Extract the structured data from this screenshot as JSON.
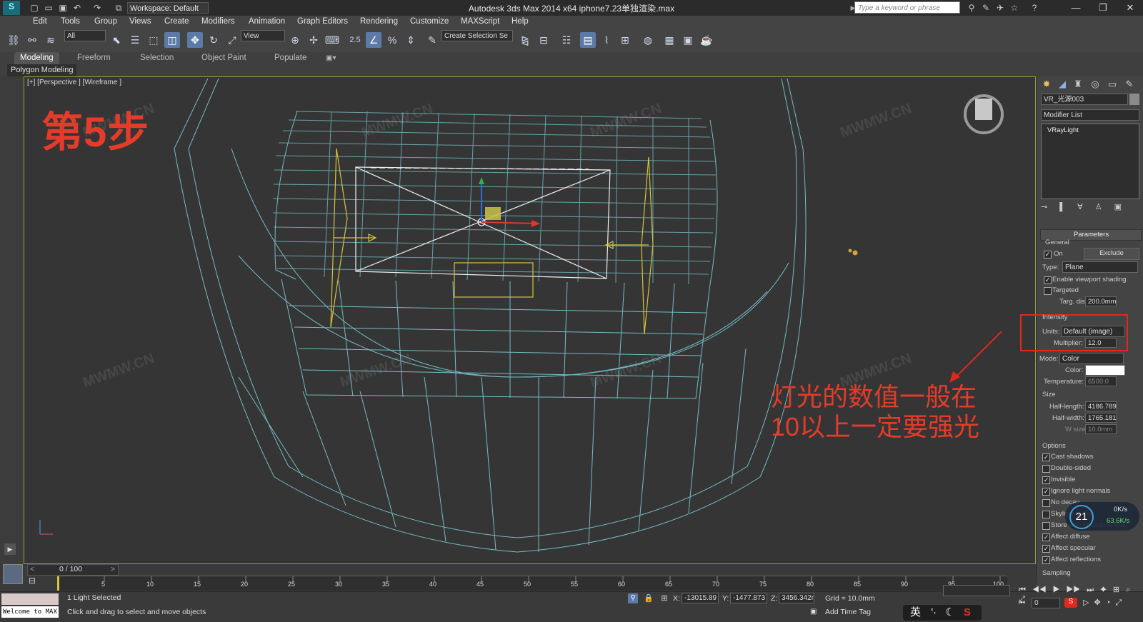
{
  "titlebar": {
    "workspace": "Workspace: Default",
    "title": "Autodesk 3ds Max  2014 x64      iphone7.23单独渲染.max",
    "search_placeholder": "Type a keyword or phrase"
  },
  "menu": [
    "Edit",
    "Tools",
    "Group",
    "Views",
    "Create",
    "Modifiers",
    "Animation",
    "Graph Editors",
    "Rendering",
    "Customize",
    "MAXScript",
    "Help"
  ],
  "toolbar": {
    "selection_filter": "All",
    "ref_coord": "View",
    "snap_value": "2.5",
    "named_selection": "Create Selection Se"
  },
  "ribbon": {
    "tabs": [
      "Modeling",
      "Freeform",
      "Selection",
      "Object Paint",
      "Populate"
    ],
    "active_tab": "Modeling",
    "panel": "Polygon Modeling"
  },
  "viewport": {
    "label": "[+] [Perspective ] [Wireframe ]",
    "step_text": "第5步",
    "annotation_line1": "灯光的数值一般在",
    "annotation_line2": "10以上一定要强光",
    "watermark": "MWMW.CN",
    "highlight_color": "#e0291c"
  },
  "command_panel": {
    "object_name": "VR_光源003",
    "modifier_list": "Modifier List",
    "stack_item": "VRayLight",
    "rollout_title": "Parameters",
    "general_label": "General",
    "on_label": "On",
    "on_checked": true,
    "exclude_label": "Exclude",
    "type_label": "Type:",
    "type_value": "Plane",
    "enable_viewport_shading": "Enable viewport shading",
    "targeted": "Targeted",
    "targ_dist_label": "Targ. dist:",
    "targ_dist_value": "200.0mm",
    "intensity_label": "Intensity",
    "units_label": "Units:",
    "units_value": "Default (image)",
    "multiplier_label": "Multiplier:",
    "multiplier_value": "12.0",
    "mode_label": "Mode:",
    "mode_value": "Color",
    "color_label": "Color:",
    "temperature_label": "Temperature:",
    "temperature_value": "6500.0",
    "size_label": "Size",
    "half_length_label": "Half-length:",
    "half_length_value": "4186.789",
    "half_width_label": "Half-width:",
    "half_width_value": "1765.181",
    "w_size_label": "W size",
    "w_size_value": "10.0mm",
    "options_label": "Options",
    "options": [
      {
        "label": "Cast shadows",
        "checked": true
      },
      {
        "label": "Double-sided",
        "checked": false
      },
      {
        "label": "Invisible",
        "checked": true
      },
      {
        "label": "Ignore light normals",
        "checked": true
      },
      {
        "label": "No decay",
        "checked": false
      },
      {
        "label": "Skylight portal",
        "checked": false
      },
      {
        "label": "Store with irradiance map",
        "checked": false
      },
      {
        "label": "Affect diffuse",
        "checked": true
      },
      {
        "label": "Affect specular",
        "checked": true
      },
      {
        "label": "Affect reflections",
        "checked": true
      }
    ],
    "sampling_label": "Sampling"
  },
  "network_widget": {
    "percent": "21",
    "up": "0K/s",
    "down": "63.6K/s"
  },
  "timeline": {
    "frame": "0 / 100",
    "ticks": [
      "5",
      "10",
      "15",
      "20",
      "25",
      "30",
      "35",
      "40",
      "45",
      "50",
      "55",
      "60",
      "65",
      "70",
      "75",
      "80",
      "85",
      "90",
      "95",
      "100"
    ]
  },
  "status": {
    "selected": "1 Light Selected",
    "prompt": "Click and drag to select and move objects",
    "welcome": "Welcome to MAX:",
    "x": "-13015.89",
    "y": "-1477.873",
    "z": "3456.342r",
    "grid": "Grid = 10.0mm",
    "add_time_tag": "Add Time Tag",
    "frame_field": "0",
    "ime": "英"
  }
}
